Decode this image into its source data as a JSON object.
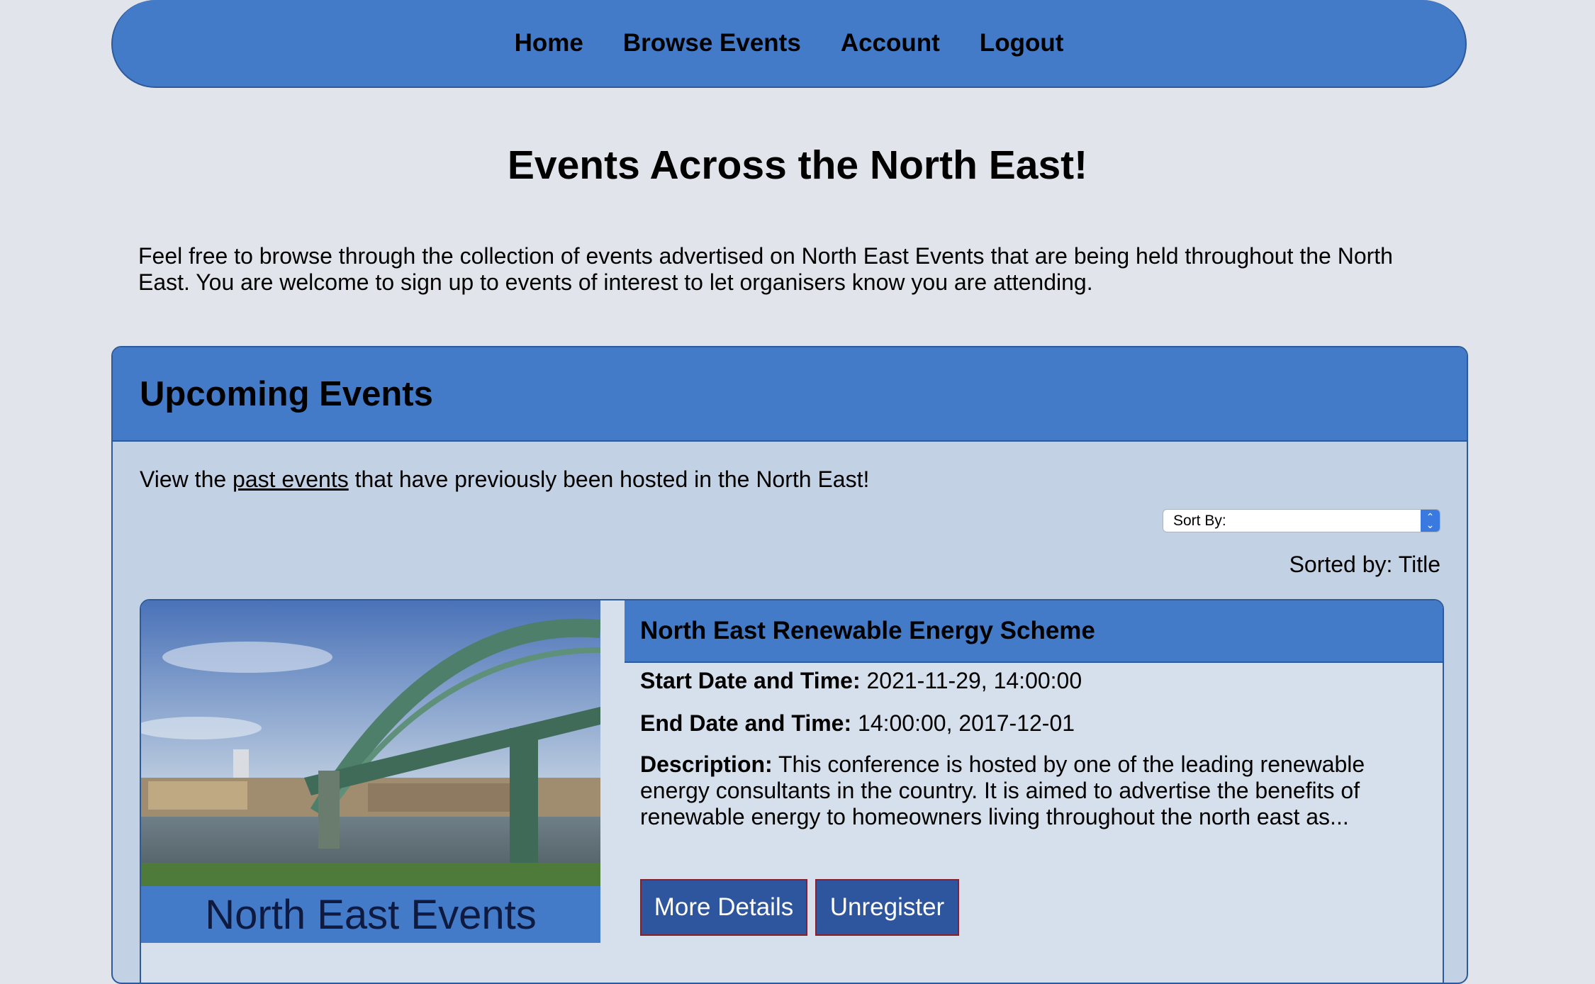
{
  "nav": {
    "items": [
      "Home",
      "Browse Events",
      "Account",
      "Logout"
    ]
  },
  "page": {
    "title": "Events Across the North East!",
    "intro": "Feel free to browse through the collection of events advertised on North East Events that are being held throughout the North East. You are welcome to sign up to events of interest to let organisers know you are attending."
  },
  "upcoming": {
    "heading": "Upcoming Events",
    "past_prefix": "View the ",
    "past_link": "past events",
    "past_suffix": " that have previously been hosted in the North East!",
    "sort_select_value": "Sort By:",
    "sorted_by": "Sorted by: Title"
  },
  "event": {
    "image_brand": "North East Events",
    "title": "North East Renewable Energy Scheme",
    "start_label": "Start Date and Time:",
    "start_value": " 2021-11-29, 14:00:00",
    "end_label": "End Date and Time:",
    "end_value": " 14:00:00, 2017-12-01",
    "description_label": "Description:",
    "description_value": " This conference is hosted by one of the leading renewable energy consultants in the country. It is aimed to advertise the benefits of renewable energy to homeowners living throughout the north east as...",
    "more_details": "More Details",
    "unregister": "Unregister"
  },
  "colors": {
    "accent": "#437bc8",
    "background": "#e1e5eb",
    "panel": "#c2d1e3",
    "button": "#2d569e"
  }
}
